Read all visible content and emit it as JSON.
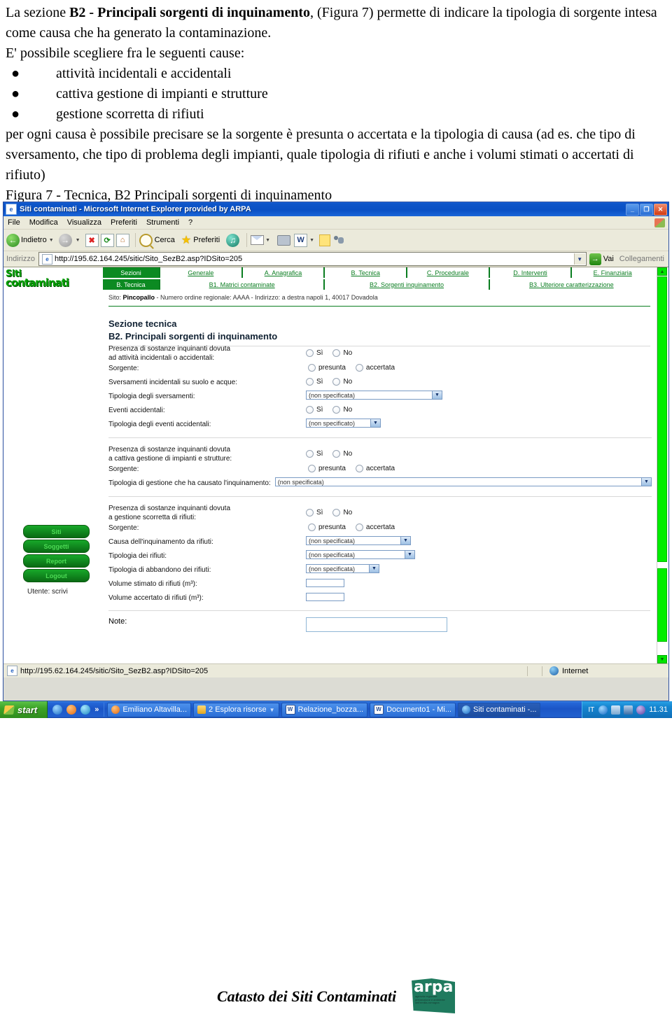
{
  "document": {
    "para1_prefix": "La sezione ",
    "para1_bold": "B2 - Principali sorgenti di inquinamento",
    "para1_suffix": ", (Figura 7) permette di indicare la tipologia di sorgente intesa come causa che ha generato la contaminazione.",
    "para2": "E' possibile scegliere fra le seguenti cause:",
    "bullets": [
      "attività incidentali e accidentali",
      "cattiva gestione di impianti e strutture",
      "gestione scorretta di rifiuti"
    ],
    "para3": "per ogni causa è possibile precisare se la sorgente è presunta o accertata e la tipologia di causa (ad es. che tipo di sversamento, che tipo di problema degli impianti, quale tipologia di rifiuti e anche i volumi stimati o accertati di rifiuto)",
    "figure_caption": "Figura 7 - Tecnica, B2 Principali sorgenti di inquinamento"
  },
  "browser": {
    "title": "Siti contaminati - Microsoft Internet Explorer provided by ARPA",
    "title_icon": "ie-document-icon",
    "minimize": "_",
    "maximize": "❐",
    "close": "✕",
    "menus": [
      "File",
      "Modifica",
      "Visualizza",
      "Preferiti",
      "Strumenti",
      "?"
    ],
    "toolbar": {
      "back": "Indietro",
      "search": "Cerca",
      "favorites": "Preferiti",
      "stop_glyph": "✖",
      "refresh_glyph": "⟳",
      "home_glyph": "⌂",
      "word_glyph": "W"
    },
    "address": {
      "label": "Indirizzo",
      "url": "http://195.62.164.245/sitic/Sito_SezB2.asp?IDSito=205",
      "go": "Vai",
      "links": "Collegamenti"
    },
    "status": {
      "url": "http://195.62.164.245/sitic/Sito_SezB2.asp?IDSito=205",
      "zone": "Internet"
    }
  },
  "app": {
    "logo_line1": "Siti",
    "logo_line2": "contaminati",
    "nav_row1_current": "Sezioni",
    "nav_row1": [
      "Generale",
      "A. Anagrafica",
      "B. Tecnica",
      "C. Procedurale",
      "D. Interventi",
      "E. Finanziaria"
    ],
    "nav_row2_current": "B. Tecnica",
    "nav_row2": [
      "B1. Matrici contaminate",
      "B2. Sorgenti inquinamento",
      "B3. Ulteriore caratterizzazione"
    ],
    "site_prefix": "Sito: ",
    "site_name": "Pincopallo",
    "site_rest": " - Numero ordine regionale: AAAA - Indirizzo: a destra napoli 1, 40017 Dovadola",
    "section_title_1": "Sezione tecnica",
    "section_title_2": "B2. Principali sorgenti di inquinamento",
    "side_buttons": [
      "Siti",
      "Soggetti",
      "Report",
      "Logout"
    ],
    "user": "Utente: scrivi",
    "note_label": "Note:",
    "note_value": ""
  },
  "form": {
    "yes": "Sì",
    "no": "No",
    "presumed": "presunta",
    "ascertained": "accertata",
    "unspecified_f": "(non specificata)",
    "unspecified_m": "(non specificato)",
    "group1": {
      "presence_line1": "Presenza di sostanze inquinanti dovuta",
      "presence_line2": "ad attività incidentali o accidentali:",
      "source": "Sorgente:",
      "spills": "Sversamenti incidentali su suolo e acque:",
      "spill_type": "Tipologia degli sversamenti:",
      "accidental_events": "Eventi accidentali:",
      "accidental_event_type": "Tipologia degli eventi accidentali:"
    },
    "group2": {
      "presence_line1": "Presenza di sostanze inquinanti dovuta",
      "presence_line2": "a cattiva gestione di impianti e strutture:",
      "source": "Sorgente:",
      "management_type": "Tipologia di gestione che ha causato l'inquinamento:"
    },
    "group3": {
      "presence_line1": "Presenza di sostanze inquinanti dovuta",
      "presence_line2": "a gestione scorretta di rifiuti:",
      "source": "Sorgente:",
      "cause": "Causa dell'inquinamento da rifiuti:",
      "waste_type": "Tipologia dei rifiuti:",
      "abandon_type": "Tipologia di abbandono dei rifiuti:",
      "volume_estimated": "Volume stimato di rifiuti (m³):",
      "volume_ascertained": "Volume accertato di rifiuti (m³):",
      "volume_estimated_value": "",
      "volume_ascertained_value": ""
    }
  },
  "taskbar": {
    "start": "start",
    "items": [
      {
        "label": "Emiliano Altavilla...",
        "icon": "orange-circle-icon"
      },
      {
        "label": "2 Esplora risorse",
        "icon": "folder-icon"
      },
      {
        "label": "Relazione_bozza...",
        "icon": "word-icon"
      },
      {
        "label": "Documento1 - Mi...",
        "icon": "word-icon"
      },
      {
        "label": "Siti contaminati -...",
        "icon": "ie-icon"
      }
    ],
    "lang": "IT",
    "clock": "11.31"
  },
  "footer": {
    "text": "Catasto dei Siti Contaminati",
    "logo_word": "arpa",
    "logo_sub": "agenzia regionale prevenzione e ambiente dell'emilia-romagna"
  },
  "colors": {
    "brand_green": "#0a7d20",
    "scroll_green": "#00ee00",
    "title_blue": "#0a50c4"
  }
}
